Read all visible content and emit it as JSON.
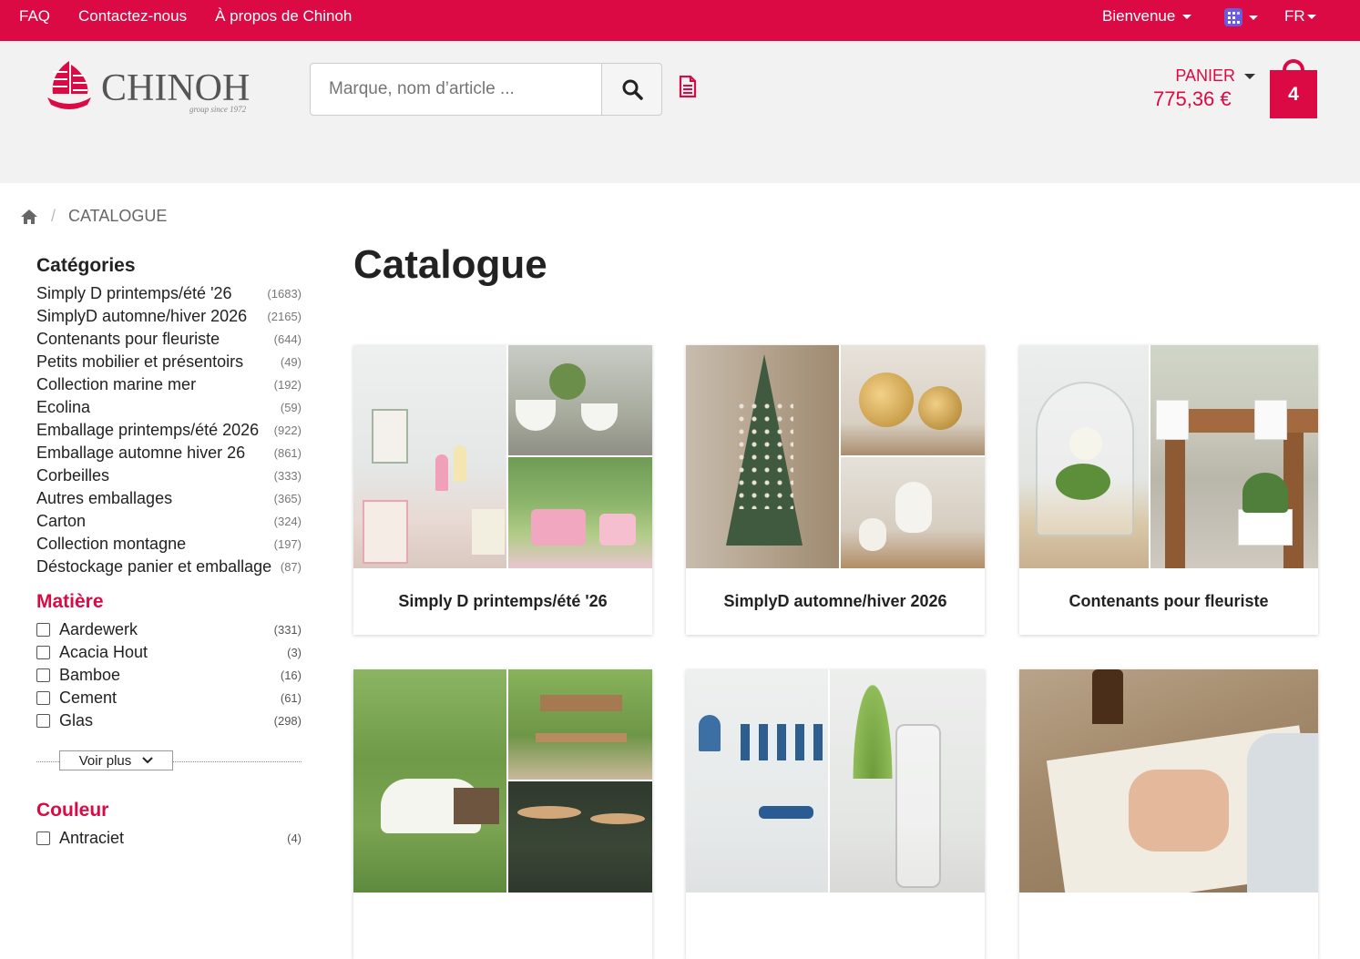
{
  "topbar": {
    "links": [
      "FAQ",
      "Contactez-nous",
      "À propos de Chinoh"
    ],
    "welcome": "Bienvenue",
    "lang": "FR"
  },
  "header": {
    "logo_brand": "CHINOH",
    "logo_tagline": "group since 1972",
    "search_placeholder": "Marque, nom d’article ...",
    "cart_label": "PANIER",
    "cart_amount": "775,36 €",
    "cart_count": "4"
  },
  "breadcrumb": {
    "current": "CATALOGUE"
  },
  "sidebar": {
    "categories_title": "Catégories",
    "categories": [
      {
        "name": "Simply D printemps/été '26",
        "count": "(1683)"
      },
      {
        "name": "SimplyD automne/hiver 2026",
        "count": "(2165)"
      },
      {
        "name": "Contenants pour fleuriste",
        "count": "(644)"
      },
      {
        "name": "Petits mobilier et présentoirs",
        "count": "(49)"
      },
      {
        "name": "Collection marine mer",
        "count": "(192)"
      },
      {
        "name": "Ecolina",
        "count": "(59)"
      },
      {
        "name": "Emballage printemps/été 2026",
        "count": "(922)"
      },
      {
        "name": "Emballage automne hiver 26",
        "count": "(861)"
      },
      {
        "name": "Corbeilles",
        "count": "(333)"
      },
      {
        "name": "Autres emballages",
        "count": "(365)"
      },
      {
        "name": "Carton",
        "count": "(324)"
      },
      {
        "name": "Collection montagne",
        "count": "(197)"
      },
      {
        "name": "Déstockage panier et emballage",
        "count": "(87)"
      }
    ],
    "material_title": "Matière",
    "materials": [
      {
        "name": "Aardewerk",
        "count": "(331)"
      },
      {
        "name": "Acacia Hout",
        "count": "(3)"
      },
      {
        "name": "Bamboe",
        "count": "(16)"
      },
      {
        "name": "Cement",
        "count": "(61)"
      },
      {
        "name": "Glas",
        "count": "(298)"
      }
    ],
    "see_more": "Voir plus",
    "color_title": "Couleur",
    "colors": [
      {
        "name": "Antraciet",
        "count": "(4)"
      }
    ]
  },
  "main": {
    "title": "Catalogue",
    "cards": [
      {
        "label": "Simply D printemps/été '26"
      },
      {
        "label": "SimplyD automne/hiver 2026"
      },
      {
        "label": "Contenants pour fleuriste"
      },
      {
        "label": ""
      },
      {
        "label": ""
      },
      {
        "label": ""
      }
    ]
  },
  "colors": {
    "brand": "#dc0a44",
    "header_bg": "#f2f2f2"
  }
}
